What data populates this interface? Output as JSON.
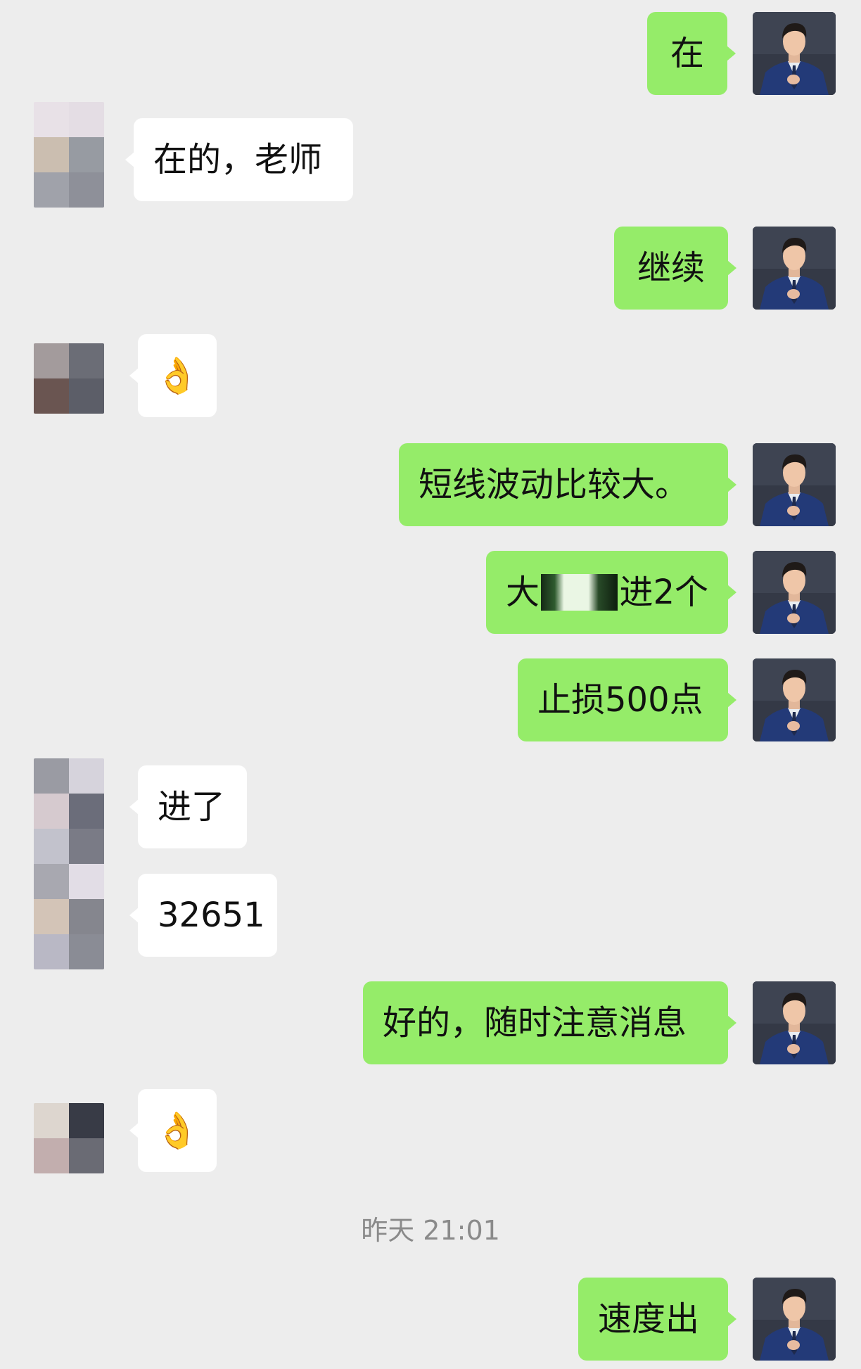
{
  "messages": [
    {
      "side": "out",
      "text": "在"
    },
    {
      "side": "in",
      "text": "在的，老师"
    },
    {
      "side": "out",
      "text": "继续"
    },
    {
      "side": "in",
      "emoji": "👌"
    },
    {
      "side": "out",
      "text": "短线波动比较大。"
    },
    {
      "side": "out",
      "text_before": "大",
      "text_after": "进2个"
    },
    {
      "side": "out",
      "text": "止损500点"
    },
    {
      "side": "in",
      "text": "进了"
    },
    {
      "side": "in",
      "text": "32651"
    },
    {
      "side": "out",
      "text": "好的，随时注意消息"
    },
    {
      "side": "in",
      "emoji": "👌"
    },
    {
      "side": "out",
      "text": "速度出"
    }
  ],
  "timestamp": "昨天 21:01",
  "colors": {
    "background": "#ededed",
    "outgoing_bubble": "#95ec69",
    "incoming_bubble": "#ffffff",
    "timestamp_text": "#8a8a8a"
  },
  "icons": {
    "my_avatar": "man-in-suit-avatar-icon",
    "peer_avatar": "pixelated-avatar-icon",
    "ok_emoji": "ok-hand-emoji"
  }
}
